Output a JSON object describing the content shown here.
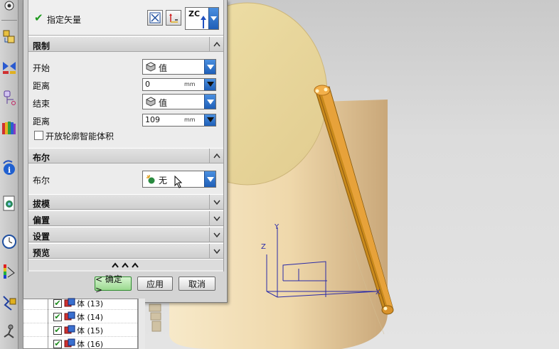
{
  "dialog": {
    "vector_label": "指定矢量",
    "vector_axis_label": "ZC",
    "limits": {
      "title": "限制",
      "start_label": "开始",
      "start_value": "值",
      "start_distance_label": "距离",
      "start_distance_value": "0",
      "start_distance_unit": "mm",
      "end_label": "结束",
      "end_value": "值",
      "end_distance_label": "距离",
      "end_distance_value": "109",
      "end_distance_unit": "mm",
      "open_profile_label": "开放轮廓智能体积"
    },
    "boolean": {
      "title": "布尔",
      "label": "布尔",
      "value": "无"
    },
    "collapsed_sections": [
      "拔模",
      "偏置",
      "设置",
      "预览"
    ],
    "more_label": "^^^",
    "buttons": {
      "ok": "< 确定 >",
      "apply": "应用",
      "cancel": "取消"
    }
  },
  "navigator": {
    "rows": [
      {
        "label": "体 (13)"
      },
      {
        "label": "体 (14)"
      },
      {
        "label": "体 (15)"
      },
      {
        "label": "体 (16)"
      }
    ]
  },
  "viewport": {
    "axis_labels": {
      "y": "Y",
      "z": "Z",
      "x": "X"
    },
    "colors": {
      "cylinder": "#f1dcae",
      "cylinder_top": "#e9d89a",
      "beam": "#c98a1c",
      "beam_highlight": "#f0a838",
      "axis": "#2020a0",
      "accent_blue": "#1f5fb8",
      "check_green": "#1e9a1e"
    }
  },
  "toolbar": {
    "icons": [
      "sketch-icon",
      "mirror-icon",
      "datum-icon",
      "book-icon",
      "info-icon",
      "document-icon",
      "clock-icon",
      "color-icon",
      "analysis-icon",
      "robot-icon"
    ]
  }
}
